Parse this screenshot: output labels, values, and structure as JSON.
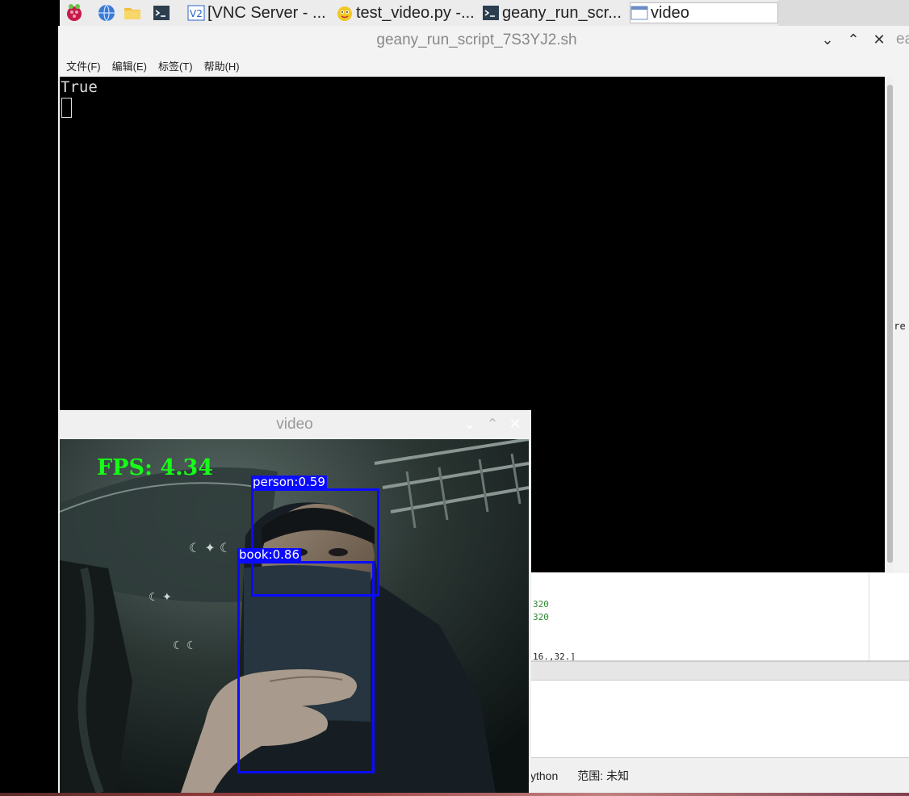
{
  "taskbar": {
    "items": [
      {
        "label": "[VNC Server - ..."
      },
      {
        "label": "test_video.py -..."
      },
      {
        "label": "geany_run_scr..."
      },
      {
        "label": "video"
      }
    ]
  },
  "terminal": {
    "title": "geany_run_script_7S3YJ2.sh",
    "menu": [
      "文件(F)",
      "编辑(E)",
      "标签(T)",
      "帮助(H)"
    ],
    "output": "True"
  },
  "background_fragments": {
    "top_right": "ea",
    "paren": ")",
    "mid": "nre",
    "code1": "320",
    "code2": "320",
    "code3": "16.,32.]",
    "status_lang": "ython",
    "status_scope": "范围: 未知"
  },
  "video": {
    "title": "video",
    "fps_label": "FPS: 4.34",
    "detections": [
      {
        "label": "person:0.59"
      },
      {
        "label": "book:0.86"
      }
    ]
  },
  "colors": {
    "bbox": "#0b0bff",
    "fps": "#16ff16"
  }
}
